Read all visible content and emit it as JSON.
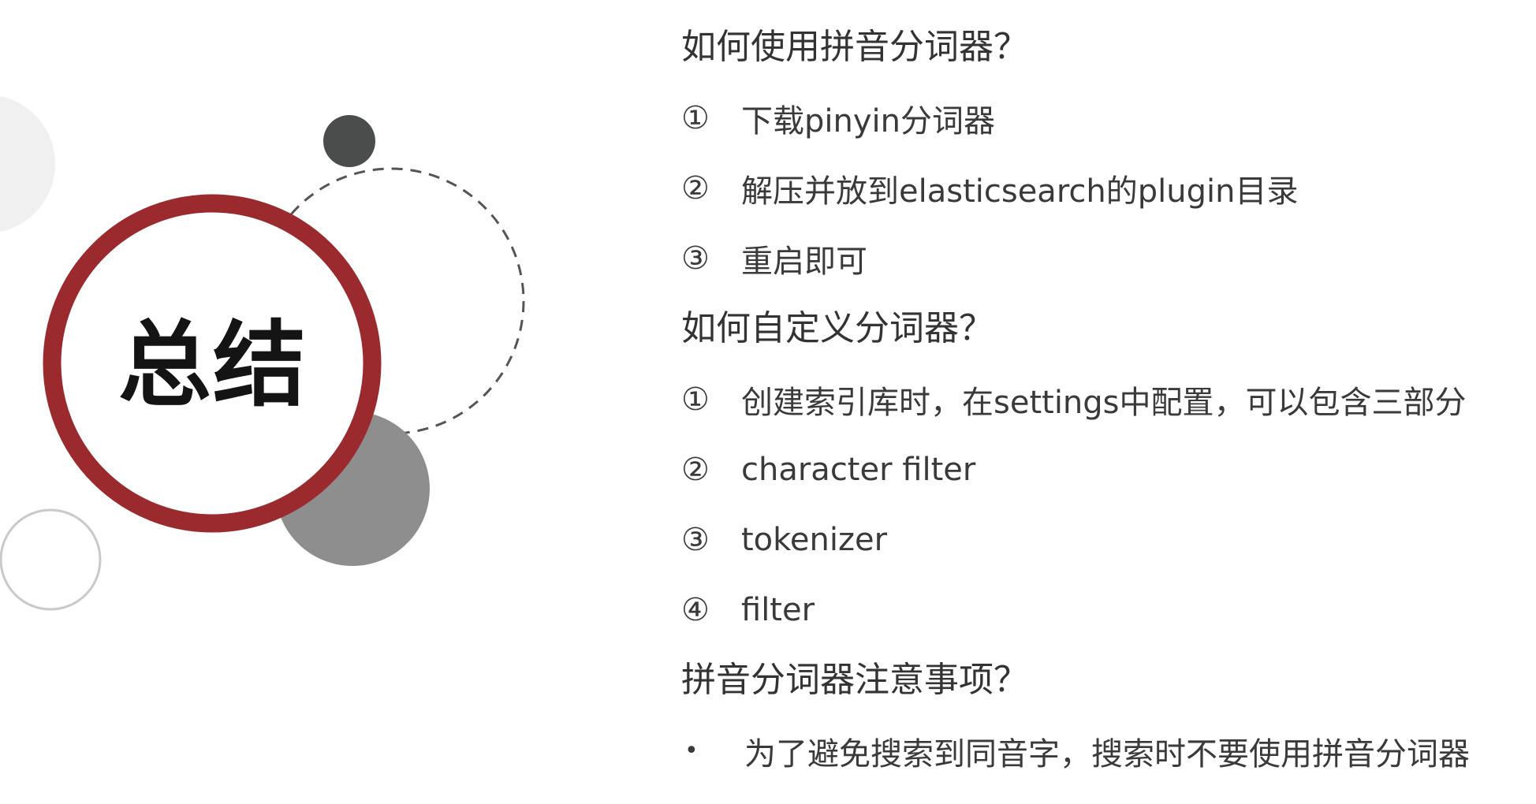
{
  "title": "总结",
  "sections": [
    {
      "heading": "如何使用拼音分词器？",
      "items": [
        {
          "marker": "①",
          "text": "下载pinyin分词器"
        },
        {
          "marker": "②",
          "text": "解压并放到elasticsearch的plugin目录"
        },
        {
          "marker": "③",
          "text": "重启即可"
        }
      ]
    },
    {
      "heading": "如何自定义分词器？",
      "items": [
        {
          "marker": "①",
          "text": "创建索引库时，在settings中配置，可以包含三部分"
        },
        {
          "marker": "②",
          "text": "character filter"
        },
        {
          "marker": "③",
          "text": "tokenizer"
        },
        {
          "marker": "④",
          "text": "filter"
        }
      ]
    },
    {
      "heading": "拼音分词器注意事项？",
      "items": [
        {
          "marker": "•",
          "text": "为了避免搜索到同音字，搜索时不要使用拼音分词器"
        }
      ]
    }
  ],
  "colors": {
    "ring": "#9b2a2f",
    "dark_circle": "#4a4d4c",
    "gray_circle": "#8e8e8e",
    "light_blob": "#f0f0f0",
    "outline_circle": "#c9c9c9",
    "dashed_circle": "#555555"
  }
}
